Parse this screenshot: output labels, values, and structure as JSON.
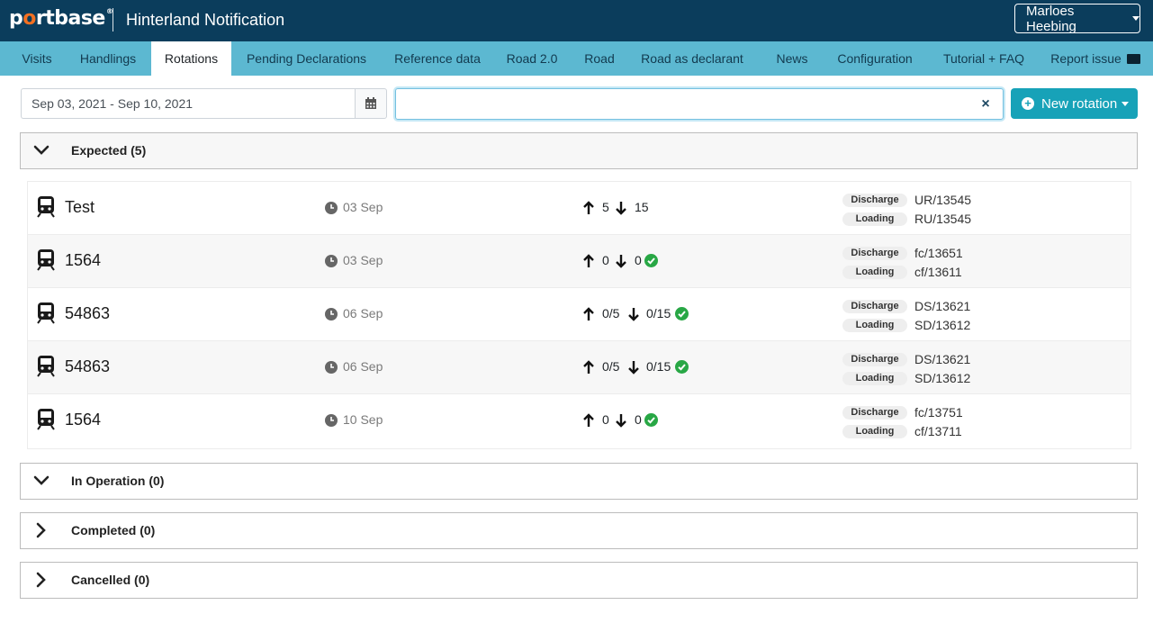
{
  "header": {
    "logo_part1": "p",
    "logo_o": "o",
    "logo_part2": "rtbase",
    "logo_mark": "®",
    "app_title": "Hinterland Notification",
    "user_name": "Marloes Heebing"
  },
  "nav": {
    "items": [
      {
        "label": "Visits"
      },
      {
        "label": "Handlings"
      },
      {
        "label": "Rotations"
      },
      {
        "label": "Pending Declarations"
      },
      {
        "label": "Reference data"
      },
      {
        "label": "Road 2.0"
      },
      {
        "label": "Road"
      },
      {
        "label": "Road as declarant"
      },
      {
        "label": "News"
      },
      {
        "label": "Configuration"
      },
      {
        "label": "Tutorial + FAQ"
      },
      {
        "label": "Report issue"
      }
    ],
    "active": "Rotations"
  },
  "filters": {
    "date_range": "Sep 03, 2021 - Sep 10, 2021",
    "search_value": "",
    "clear_symbol": "×",
    "new_rotation_label": "New rotation"
  },
  "sections": {
    "expected": "Expected (5)",
    "in_operation": "In Operation (0)",
    "completed": "Completed (0)",
    "cancelled": "Cancelled (0)"
  },
  "labels": {
    "discharge": "Discharge",
    "loading": "Loading"
  },
  "rotations": [
    {
      "name": "Test",
      "date": "03 Sep",
      "discharge": "5",
      "loading": "15",
      "complete": false,
      "discharge_ref": "UR/13545",
      "loading_ref": "RU/13545"
    },
    {
      "name": "1564",
      "date": "03 Sep",
      "discharge": "0",
      "loading": "0",
      "complete": true,
      "discharge_ref": "fc/13651",
      "loading_ref": "cf/13611"
    },
    {
      "name": "54863",
      "date": "06 Sep",
      "discharge": "0/5",
      "loading": "0/15",
      "complete": true,
      "discharge_ref": "DS/13621",
      "loading_ref": "SD/13612"
    },
    {
      "name": "54863",
      "date": "06 Sep",
      "discharge": "0/5",
      "loading": "0/15",
      "complete": true,
      "discharge_ref": "DS/13621",
      "loading_ref": "SD/13612"
    },
    {
      "name": "1564",
      "date": "10 Sep",
      "discharge": "0",
      "loading": "0",
      "complete": true,
      "discharge_ref": "fc/13751",
      "loading_ref": "cf/13711"
    }
  ],
  "colors": {
    "header_bg": "#0b3d5c",
    "nav_bg": "#5cb8d1",
    "accent": "#17a2b8",
    "logo_accent": "#f37021",
    "success": "#28a745"
  },
  "icons": {
    "calendar": "calendar-icon",
    "clear": "close-icon",
    "new_rotation": "plus-circle-icon",
    "mail": "envelope-icon",
    "expand": "chevron-down-icon",
    "collapse": "chevron-right-icon",
    "train": "train-icon",
    "time": "clock-icon",
    "discharge": "arrow-up-icon",
    "loading": "arrow-down-icon",
    "status": "check-circle-icon"
  }
}
